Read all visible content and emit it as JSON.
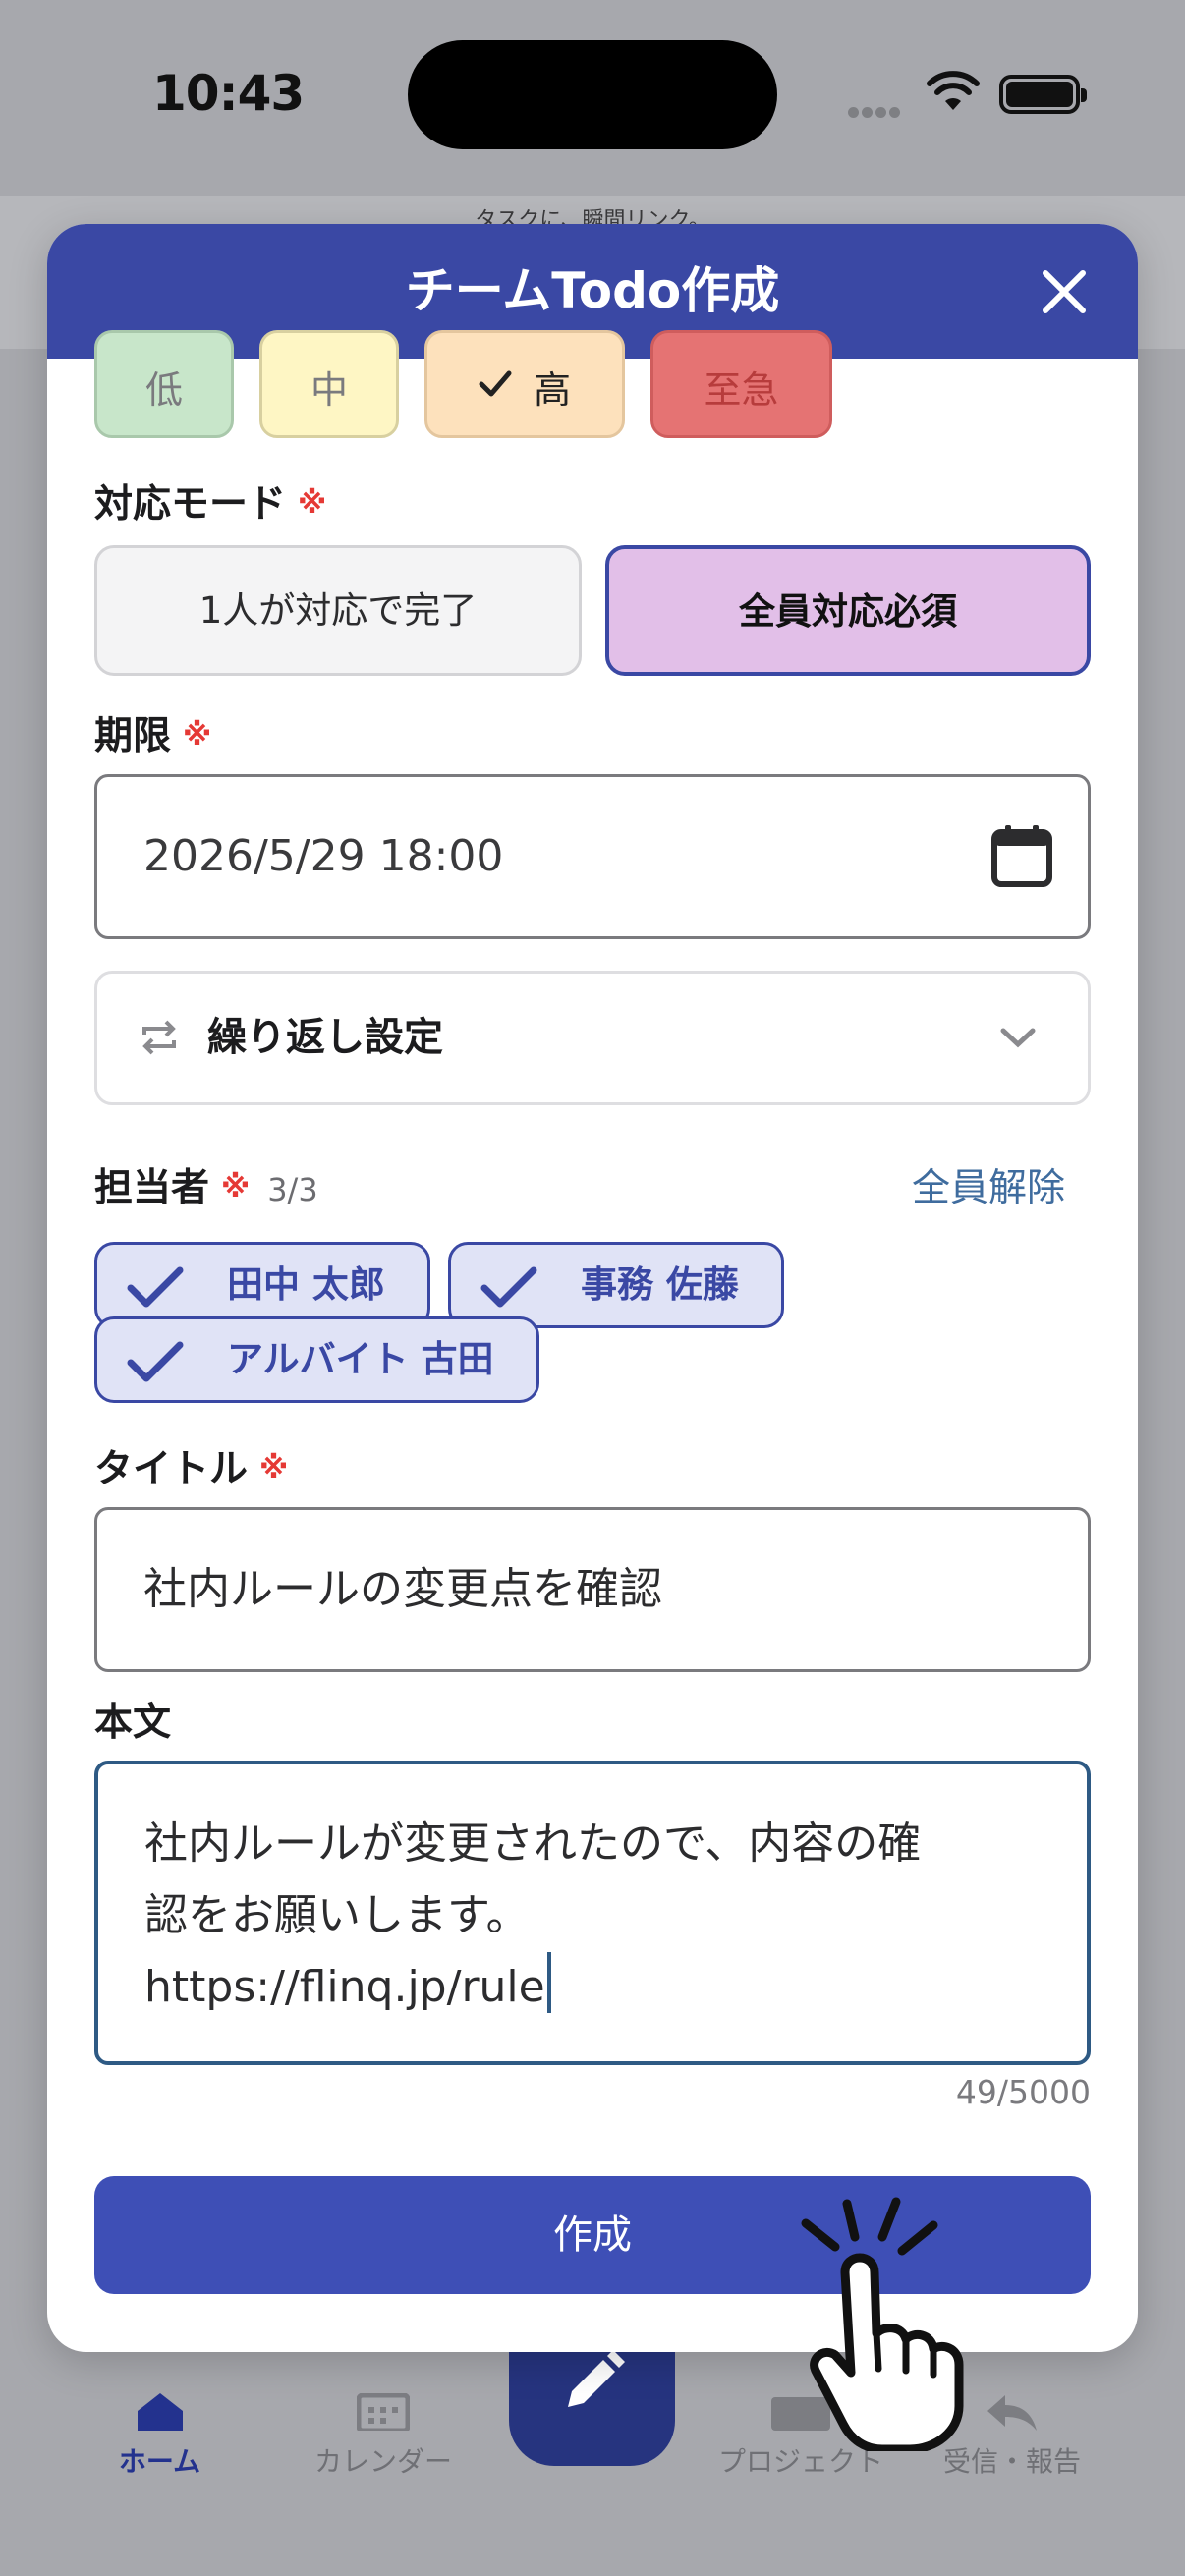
{
  "status_bar": {
    "time": "10:43"
  },
  "background": {
    "top_text": "タスクに、瞬間リンク。",
    "tabs": [
      {
        "label": "ホーム"
      },
      {
        "label": "カレンダー"
      },
      {
        "label": "プロジェクト"
      },
      {
        "label": "受信・報告"
      }
    ]
  },
  "modal": {
    "title": "チームTodo作成",
    "priority": {
      "options": [
        {
          "label": "低"
        },
        {
          "label": "中"
        },
        {
          "label": "高",
          "selected": true
        },
        {
          "label": "至急"
        }
      ]
    },
    "mode": {
      "label": "対応モード",
      "required_mark": "※",
      "options": [
        {
          "label": "1人が対応で完了"
        },
        {
          "label": "全員対応必須",
          "selected": true
        }
      ]
    },
    "deadline": {
      "label": "期限",
      "required_mark": "※",
      "value": "2026/5/29 18:00"
    },
    "repeat": {
      "label": "繰り返し設定"
    },
    "assignees": {
      "label": "担当者",
      "required_mark": "※",
      "count": "3/3",
      "clear_all": "全員解除",
      "chips": [
        {
          "label": "田中 太郎"
        },
        {
          "label": "事務 佐藤"
        },
        {
          "label": "アルバイト 古田"
        }
      ]
    },
    "title_field": {
      "label": "タイトル",
      "required_mark": "※",
      "value": "社内ルールの変更点を確認"
    },
    "body_field": {
      "label": "本文",
      "lines": [
        "社内ルールが変更されたので、内容の確",
        "認をお願いします。",
        "https://flinq.jp/rule"
      ],
      "char_count": "49/5000"
    },
    "submit_label": "作成"
  },
  "colors": {
    "primary": "#3a48a4",
    "required": "#e53935",
    "link": "#3f6c9e"
  }
}
